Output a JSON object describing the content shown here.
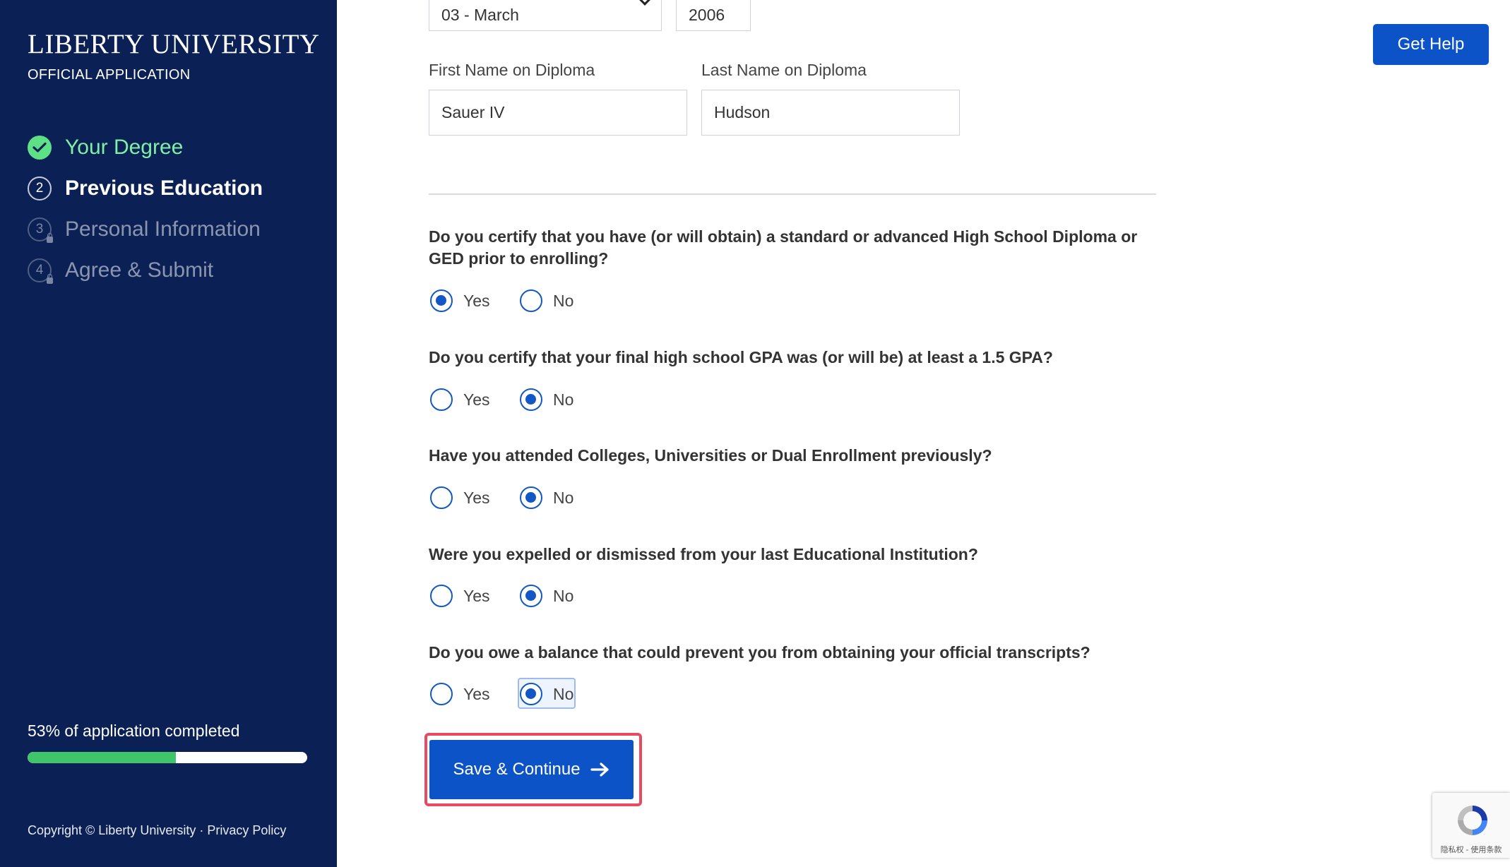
{
  "sidebar": {
    "brand_name": "LIBERTY UNIVERSITY",
    "brand_sub": "OFFICIAL APPLICATION",
    "steps": [
      {
        "number": "",
        "label": "Your Degree",
        "status": "complete"
      },
      {
        "number": "2",
        "label": "Previous Education",
        "status": "current"
      },
      {
        "number": "3",
        "label": "Personal Information",
        "status": "locked"
      },
      {
        "number": "4",
        "label": "Agree & Submit",
        "status": "locked"
      }
    ],
    "progress_text": "53% of application completed",
    "progress_value": 0.53,
    "footer": {
      "copyright": "Copyright © Liberty University",
      "separator": " · ",
      "privacy": "Privacy Policy"
    }
  },
  "form": {
    "month_select": "03 - March",
    "year_value": "2006",
    "first_name_label": "First Name on Diploma",
    "first_name_value": "Sauer IV",
    "last_name_label": "Last Name on Diploma",
    "last_name_value": "Hudson",
    "questions": [
      {
        "text": "Do you certify that you have (or will obtain) a standard or advanced High School Diploma or GED prior to enrolling?",
        "yes": "Yes",
        "no": "No",
        "selected": "yes"
      },
      {
        "text": "Do you certify that your final high school GPA was (or will be) at least a 1.5 GPA?",
        "yes": "Yes",
        "no": "No",
        "selected": "no"
      },
      {
        "text": "Have you attended Colleges, Universities or Dual Enrollment previously?",
        "yes": "Yes",
        "no": "No",
        "selected": "no"
      },
      {
        "text": "Were you expelled or dismissed from your last Educational Institution?",
        "yes": "Yes",
        "no": "No",
        "selected": "no"
      },
      {
        "text": "Do you owe a balance that could prevent you from obtaining your official transcripts?",
        "yes": "Yes",
        "no": "No",
        "selected": "no"
      }
    ],
    "save_label": "Save & Continue"
  },
  "header": {
    "help_label": "Get Help"
  },
  "recaptcha": {
    "text": "隐私权 - 使用条款"
  },
  "colors": {
    "sidebar_bg": "#0b2155",
    "primary": "#0c53c7",
    "complete_green": "#5ee087",
    "highlight": "#e84a5f"
  }
}
